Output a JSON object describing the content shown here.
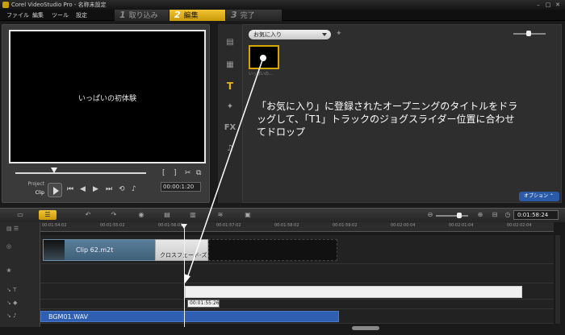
{
  "window": {
    "title": "Corel VideoStudio Pro - 名称未設定"
  },
  "menu": {
    "items": [
      "ファイル",
      "編集",
      "ツール",
      "設定"
    ]
  },
  "steps": [
    {
      "num": "1",
      "label": "取り込み"
    },
    {
      "num": "2",
      "label": "編集"
    },
    {
      "num": "3",
      "label": "完了"
    }
  ],
  "preview": {
    "title_text": "いっぱいの初体験",
    "mode_project": "Project",
    "mode_clip": "Clip",
    "timecode": "00:00:1:20",
    "bracket_in": "[",
    "bracket_out": "]"
  },
  "library": {
    "dropdown": "お気に入り",
    "thumb_label": "いっぱいの...",
    "option_label": "オプション"
  },
  "annotation": {
    "text": "「お気に入り」に登録されたオープニングのタイトルをドラッグして、「T1」トラックのジョグスライダー位置に合わせてドロップ"
  },
  "timeline": {
    "timecode": "0:01:58:24",
    "ruler": [
      "00:01:54:02",
      "00:01:55:02",
      "00:01:56:02",
      "00:01:57:02",
      "00:01:58:02",
      "00:01:59:02",
      "00:02:00:04",
      "00:02:01:04",
      "00:02:02:04"
    ],
    "clip_video": "Clip 62.m2t",
    "clip_transition": "クロスフェード-ズ",
    "clip_audio": "BGM01.WAV",
    "tooltip_tc": "00:01:55:26",
    "track_labels": {
      "title": "T",
      "voice": "♪"
    }
  },
  "colors": {
    "accent": "#e8b619",
    "audio": "#2f5fb0",
    "video": "#4d7089"
  }
}
